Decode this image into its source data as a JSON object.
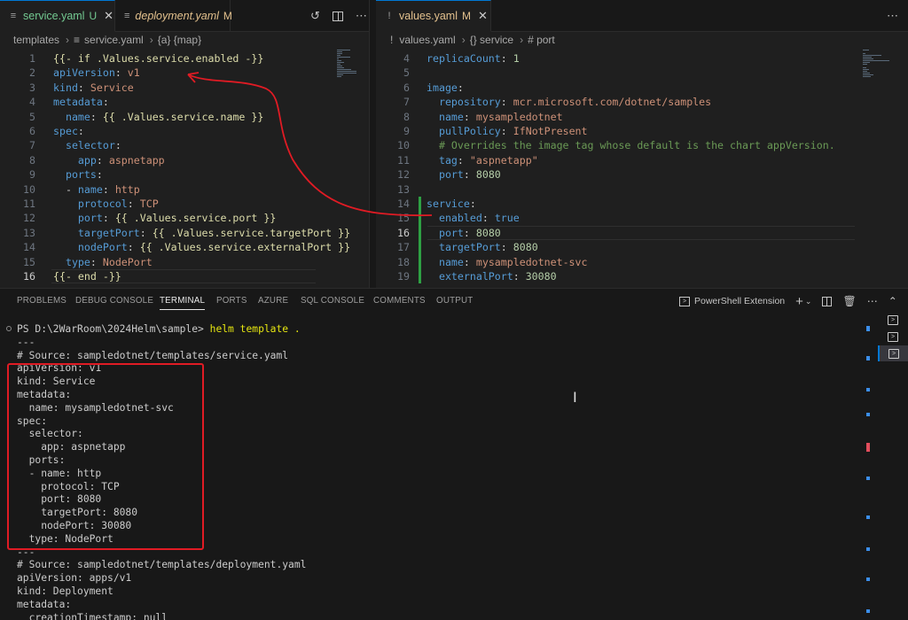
{
  "left_editor": {
    "tabs": [
      {
        "icon": "lines-file-icon",
        "name": "service.yaml",
        "status": "U",
        "active": true
      },
      {
        "icon": "exclamation-file-icon",
        "name": "deployment.yaml",
        "status": "M",
        "active": false
      }
    ],
    "breadcrumb": [
      "templates",
      "service.yaml",
      "{a} {map}"
    ],
    "lines": [
      {
        "n": "1",
        "tokens": [
          [
            "t",
            "{{- if .Values.service.enabled -}}"
          ]
        ]
      },
      {
        "n": "2",
        "tokens": [
          [
            "k",
            "apiVersion"
          ],
          [
            "w",
            ": "
          ],
          [
            "v",
            "v1"
          ]
        ]
      },
      {
        "n": "3",
        "tokens": [
          [
            "k",
            "kind"
          ],
          [
            "w",
            ": "
          ],
          [
            "v",
            "Service"
          ]
        ]
      },
      {
        "n": "4",
        "tokens": [
          [
            "k",
            "metadata"
          ],
          [
            "w",
            ":"
          ]
        ]
      },
      {
        "n": "5",
        "tokens": [
          [
            "w",
            "  "
          ],
          [
            "k",
            "name"
          ],
          [
            "w",
            ": "
          ],
          [
            "t",
            "{{ .Values.service.name }}"
          ]
        ]
      },
      {
        "n": "6",
        "tokens": [
          [
            "k",
            "spec"
          ],
          [
            "w",
            ":"
          ]
        ]
      },
      {
        "n": "7",
        "tokens": [
          [
            "w",
            "  "
          ],
          [
            "k",
            "selector"
          ],
          [
            "w",
            ":"
          ]
        ]
      },
      {
        "n": "8",
        "tokens": [
          [
            "w",
            "    "
          ],
          [
            "k",
            "app"
          ],
          [
            "w",
            ": "
          ],
          [
            "v",
            "aspnetapp"
          ]
        ]
      },
      {
        "n": "9",
        "tokens": [
          [
            "w",
            "  "
          ],
          [
            "k",
            "ports"
          ],
          [
            "w",
            ":"
          ]
        ]
      },
      {
        "n": "10",
        "tokens": [
          [
            "w",
            "  - "
          ],
          [
            "k",
            "name"
          ],
          [
            "w",
            ": "
          ],
          [
            "v",
            "http"
          ]
        ]
      },
      {
        "n": "11",
        "tokens": [
          [
            "w",
            "    "
          ],
          [
            "k",
            "protocol"
          ],
          [
            "w",
            ": "
          ],
          [
            "v",
            "TCP"
          ]
        ]
      },
      {
        "n": "12",
        "tokens": [
          [
            "w",
            "    "
          ],
          [
            "k",
            "port"
          ],
          [
            "w",
            ": "
          ],
          [
            "t",
            "{{ .Values.service.port }}"
          ]
        ]
      },
      {
        "n": "13",
        "tokens": [
          [
            "w",
            "    "
          ],
          [
            "k",
            "targetPort"
          ],
          [
            "w",
            ": "
          ],
          [
            "t",
            "{{ .Values.service.targetPort }}"
          ]
        ]
      },
      {
        "n": "14",
        "tokens": [
          [
            "w",
            "    "
          ],
          [
            "k",
            "nodePort"
          ],
          [
            "w",
            ": "
          ],
          [
            "t",
            "{{ .Values.service.externalPort }}"
          ]
        ]
      },
      {
        "n": "15",
        "tokens": [
          [
            "w",
            "  "
          ],
          [
            "k",
            "type"
          ],
          [
            "w",
            ": "
          ],
          [
            "v",
            "NodePort"
          ]
        ]
      },
      {
        "n": "16",
        "tokens": [
          [
            "t",
            "{{- end -}}"
          ]
        ],
        "current": true
      }
    ]
  },
  "right_editor": {
    "tabs": [
      {
        "icon": "exclamation-file-icon",
        "name": "values.yaml",
        "status": "M",
        "active": true
      }
    ],
    "breadcrumb": [
      "values.yaml",
      "{} service",
      "# port"
    ],
    "lines": [
      {
        "n": "4",
        "tokens": [
          [
            "k",
            "replicaCount"
          ],
          [
            "w",
            ": "
          ],
          [
            "n",
            "1"
          ]
        ]
      },
      {
        "n": "5",
        "tokens": []
      },
      {
        "n": "6",
        "tokens": [
          [
            "k",
            "image"
          ],
          [
            "w",
            ":"
          ]
        ]
      },
      {
        "n": "7",
        "tokens": [
          [
            "w",
            "  "
          ],
          [
            "k",
            "repository"
          ],
          [
            "w",
            ": "
          ],
          [
            "v",
            "mcr.microsoft.com/dotnet/samples"
          ]
        ]
      },
      {
        "n": "8",
        "tokens": [
          [
            "w",
            "  "
          ],
          [
            "k",
            "name"
          ],
          [
            "w",
            ": "
          ],
          [
            "v",
            "mysampledotnet"
          ]
        ]
      },
      {
        "n": "9",
        "tokens": [
          [
            "w",
            "  "
          ],
          [
            "k",
            "pullPolicy"
          ],
          [
            "w",
            ": "
          ],
          [
            "v",
            "IfNotPresent"
          ]
        ]
      },
      {
        "n": "10",
        "tokens": [
          [
            "c",
            "  # Overrides the image tag whose default is the chart appVersion."
          ]
        ]
      },
      {
        "n": "11",
        "tokens": [
          [
            "w",
            "  "
          ],
          [
            "k",
            "tag"
          ],
          [
            "w",
            ": "
          ],
          [
            "v",
            "\"aspnetapp\""
          ]
        ]
      },
      {
        "n": "12",
        "tokens": [
          [
            "w",
            "  "
          ],
          [
            "k",
            "port"
          ],
          [
            "w",
            ": "
          ],
          [
            "n",
            "8080"
          ]
        ]
      },
      {
        "n": "13",
        "tokens": []
      },
      {
        "n": "14",
        "tokens": [
          [
            "k",
            "service"
          ],
          [
            "w",
            ":"
          ]
        ]
      },
      {
        "n": "15",
        "tokens": [
          [
            "w",
            "  "
          ],
          [
            "k",
            "enabled"
          ],
          [
            "w",
            ": "
          ],
          [
            "k",
            "true"
          ]
        ]
      },
      {
        "n": "16",
        "tokens": [
          [
            "w",
            "  "
          ],
          [
            "k",
            "port"
          ],
          [
            "w",
            ": "
          ],
          [
            "n",
            "8080"
          ]
        ],
        "current": true
      },
      {
        "n": "17",
        "tokens": [
          [
            "w",
            "  "
          ],
          [
            "k",
            "targetPort"
          ],
          [
            "w",
            ": "
          ],
          [
            "n",
            "8080"
          ]
        ]
      },
      {
        "n": "18",
        "tokens": [
          [
            "w",
            "  "
          ],
          [
            "k",
            "name"
          ],
          [
            "w",
            ": "
          ],
          [
            "v",
            "mysampledotnet-svc"
          ]
        ]
      },
      {
        "n": "19",
        "tokens": [
          [
            "w",
            "  "
          ],
          [
            "k",
            "externalPort"
          ],
          [
            "w",
            ": "
          ],
          [
            "n",
            "30080"
          ]
        ]
      }
    ]
  },
  "panel": {
    "tabs": [
      "PROBLEMS",
      "DEBUG CONSOLE",
      "TERMINAL",
      "PORTS",
      "AZURE",
      "SQL CONSOLE",
      "COMMENTS",
      "OUTPUT"
    ],
    "active_tab": "TERMINAL",
    "terminal_name": "PowerShell Extension",
    "terminal": {
      "prompt": "PS D:\\2WarRoom\\2024Helm\\sample>",
      "command": "helm template .",
      "output": [
        "---",
        "# Source: sampledotnet/templates/service.yaml",
        "apiVersion: v1",
        "kind: Service",
        "metadata:",
        "  name: mysampledotnet-svc",
        "spec:",
        "  selector:",
        "    app: aspnetapp",
        "  ports:",
        "  - name: http",
        "    protocol: TCP",
        "    port: 8080",
        "    targetPort: 8080",
        "    nodePort: 30080",
        "  type: NodePort",
        "---",
        "# Source: sampledotnet/templates/deployment.yaml",
        "apiVersion: apps/v1",
        "kind: Deployment",
        "metadata:",
        "  creationTimestamp: null"
      ]
    }
  },
  "colors": {
    "accent": "#0078d4",
    "annotation_red": "#e01b24",
    "git_added": "#2ea043"
  }
}
